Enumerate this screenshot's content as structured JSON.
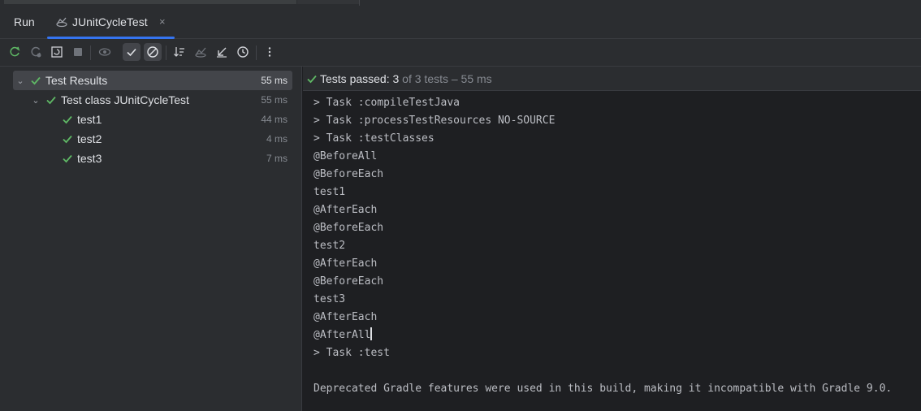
{
  "tabs": {
    "run_label": "Run",
    "active_label": "JUnitCycleTest",
    "close_glyph": "×"
  },
  "toolbar": {
    "buttons": [
      {
        "name": "rerun-icon"
      },
      {
        "name": "rerun-failed-icon"
      },
      {
        "name": "toggle-auto-test-icon"
      },
      {
        "name": "stop-icon"
      },
      {
        "name": "show-ignored-icon"
      },
      {
        "name": "show-passed-icon",
        "active": true
      },
      {
        "name": "show-ignored-toggle-icon",
        "active": true
      },
      {
        "name": "sort-icon"
      },
      {
        "name": "import-tests-icon"
      },
      {
        "name": "expand-icon"
      },
      {
        "name": "history-icon"
      },
      {
        "name": "more-icon"
      }
    ]
  },
  "tree": {
    "root": {
      "label": "Test Results",
      "time": "55 ms"
    },
    "class": {
      "label": "Test class JUnitCycleTest",
      "time": "55 ms"
    },
    "tests": [
      {
        "label": "test1",
        "time": "44 ms"
      },
      {
        "label": "test2",
        "time": "4 ms"
      },
      {
        "label": "test3",
        "time": "7 ms"
      }
    ]
  },
  "status": {
    "prefix": "Tests passed: ",
    "count": "3",
    "suffix": " of 3 tests – 55 ms"
  },
  "console": {
    "lines": [
      "> Task :compileTestJava",
      "> Task :processTestResources NO-SOURCE",
      "> Task :testClasses",
      "@BeforeAll",
      "@BeforeEach",
      "test1",
      "@AfterEach",
      "@BeforeEach",
      "test2",
      "@AfterEach",
      "@BeforeEach",
      "test3",
      "@AfterEach",
      "@AfterAll",
      "> Task :test",
      "",
      "Deprecated Gradle features were used in this build, making it incompatible with Gradle 9.0."
    ]
  },
  "colors": {
    "accent": "#3574f0",
    "pass": "#5fb865"
  }
}
